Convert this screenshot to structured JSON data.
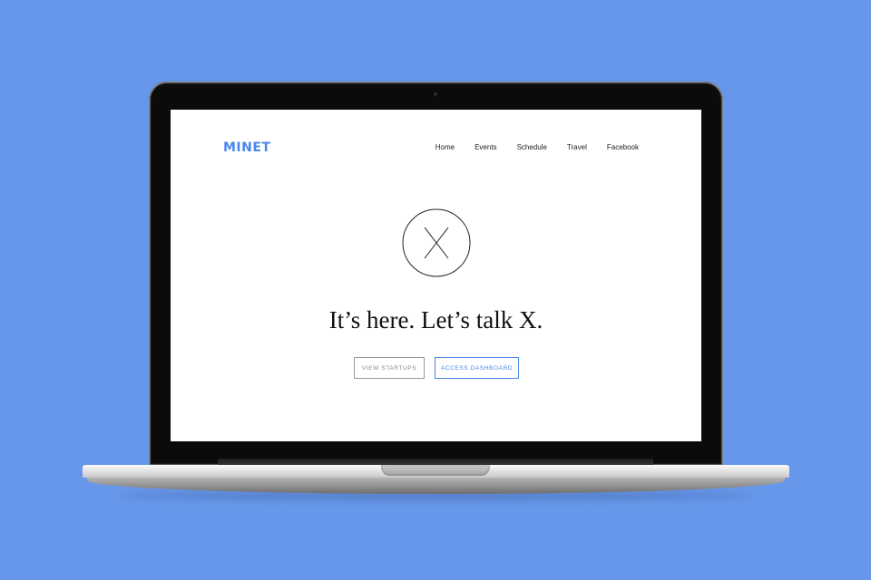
{
  "colors": {
    "background": "#6797EA",
    "brand": "#4A87E8",
    "secondary_border": "#9a9a9a"
  },
  "site": {
    "logo": "MINET",
    "nav": [
      "Home",
      "Events",
      "Schedule",
      "Travel",
      "Facebook"
    ],
    "hero_icon": "x-circle-icon",
    "headline": "It’s here. Let’s talk X.",
    "buttons": {
      "view_startups": "VIEW STARTUPS",
      "access_dashboard": "ACCESS DASHBOARD"
    }
  }
}
